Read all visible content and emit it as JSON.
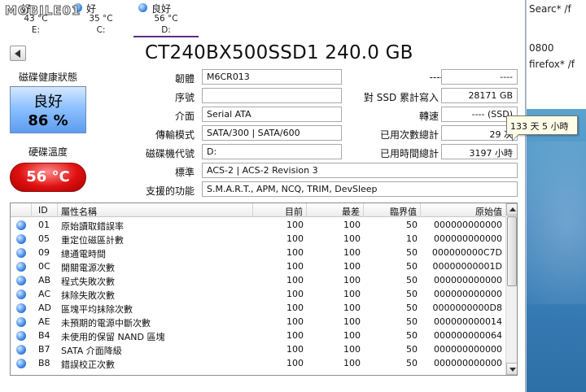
{
  "background_window": {
    "lines": [
      "Searc* /f",
      "0800",
      "firefox* /f"
    ]
  },
  "logo_text": "MOBILE01",
  "drives": [
    {
      "status": "好",
      "temp": "43 °C",
      "letter": "E:"
    },
    {
      "status": "好",
      "temp": "35 °C",
      "letter": "C:"
    },
    {
      "status": "良好",
      "temp": "56 °C",
      "letter": "D:"
    }
  ],
  "title": "CT240BX500SSD1 240.0 GB",
  "health": {
    "label": "磁碟健康狀態",
    "status": "良好",
    "percent": "86 %"
  },
  "temperature": {
    "label": "硬碟溫度",
    "value": "56 °C"
  },
  "fields": {
    "firmware": {
      "label": "韌體",
      "value": "M6CR013"
    },
    "serial": {
      "label": "序號",
      "value": ""
    },
    "interface": {
      "label": "介面",
      "value": "Serial ATA"
    },
    "transfer_mode": {
      "label": "傳輸模式",
      "value": "SATA/300 | SATA/600"
    },
    "drive_letter": {
      "label": "磁碟機代號",
      "value": "D:"
    },
    "standard": {
      "label": "標準",
      "value": "ACS-2 | ACS-2 Revision 3"
    },
    "features": {
      "label": "支援的功能",
      "value": "S.M.A.R.T., APM, NCQ, TRIM, DevSleep"
    },
    "right_top": {
      "label": "----",
      "value": "----"
    },
    "total_writes": {
      "label": "對 SSD 累計寫入",
      "value": "28171 GB"
    },
    "rotation": {
      "label": "轉速",
      "value": "---- (SSD)"
    },
    "power_on_count": {
      "label": "已用次數總計",
      "value": "29 次"
    },
    "power_on_hours": {
      "label": "已用時間總計",
      "value": "3197 小時"
    }
  },
  "tooltip": "133 天 5 小時",
  "table": {
    "headers": [
      "",
      "ID",
      "屬性名稱",
      "目前",
      "最差",
      "臨界值",
      "原始值"
    ],
    "rows": [
      {
        "id": "01",
        "name": "原始讀取錯誤率",
        "current": "100",
        "worst": "100",
        "threshold": "50",
        "raw": "000000000000"
      },
      {
        "id": "05",
        "name": "重定位磁區計數",
        "current": "100",
        "worst": "100",
        "threshold": "10",
        "raw": "000000000000"
      },
      {
        "id": "09",
        "name": "總通電時間",
        "current": "100",
        "worst": "100",
        "threshold": "50",
        "raw": "000000000C7D"
      },
      {
        "id": "0C",
        "name": "開關電源次數",
        "current": "100",
        "worst": "100",
        "threshold": "50",
        "raw": "00000000001D"
      },
      {
        "id": "AB",
        "name": "程式失敗次數",
        "current": "100",
        "worst": "100",
        "threshold": "50",
        "raw": "000000000000"
      },
      {
        "id": "AC",
        "name": "抹除失敗次數",
        "current": "100",
        "worst": "100",
        "threshold": "50",
        "raw": "000000000000"
      },
      {
        "id": "AD",
        "name": "區塊平均抹除次數",
        "current": "100",
        "worst": "100",
        "threshold": "50",
        "raw": "0000000000D8"
      },
      {
        "id": "AE",
        "name": "未預期的電源中斷次數",
        "current": "100",
        "worst": "100",
        "threshold": "50",
        "raw": "000000000014"
      },
      {
        "id": "B4",
        "name": "未使用的保留 NAND 區塊",
        "current": "100",
        "worst": "100",
        "threshold": "50",
        "raw": "000000000064"
      },
      {
        "id": "B7",
        "name": "SATA 介面降級",
        "current": "100",
        "worst": "100",
        "threshold": "50",
        "raw": "000000000000"
      },
      {
        "id": "B8",
        "name": "錯誤校正次數",
        "current": "100",
        "worst": "100",
        "threshold": "50",
        "raw": "000000000000"
      }
    ]
  },
  "colors": {
    "health_blue": "#5c9cf0",
    "temp_red": "#e01010",
    "active_tab_underline": "#5a2d82"
  }
}
